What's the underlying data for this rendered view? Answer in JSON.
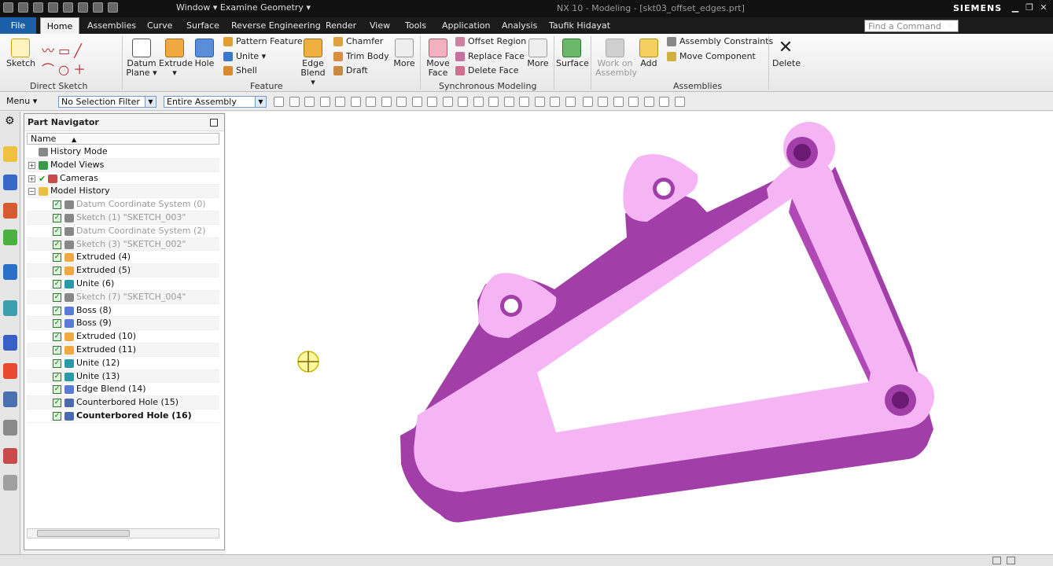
{
  "titlebar": {
    "window_menu": "Window ▾ Examine Geometry ▾",
    "app_title": "NX 10 - Modeling - [skt03_offset_edges.prt]",
    "brand": "SIEMENS"
  },
  "menubar": {
    "tabs": [
      "File",
      "Home",
      "Assemblies",
      "Curve",
      "Surface",
      "Reverse Engineering",
      "Render",
      "View",
      "Tools",
      "Application",
      "Analysis",
      "Taufik Hidayat"
    ],
    "active_tab": "Home",
    "find_placeholder": "Find a Command"
  },
  "ribbon": {
    "direct_sketch": {
      "label": "Direct Sketch",
      "sketch": "Sketch"
    },
    "feature": {
      "label": "Feature",
      "datum_plane": [
        "Datum",
        "Plane ▾"
      ],
      "extrude": [
        "Extrude",
        "▾"
      ],
      "hole": "Hole",
      "pattern_feature": "Pattern Feature",
      "unite": "Unite ▾",
      "shell": "Shell",
      "edge_blend": [
        "Edge",
        "Blend ▾"
      ],
      "chamfer": "Chamfer",
      "trim_body": "Trim Body",
      "draft": "Draft",
      "more": "More"
    },
    "sync": {
      "label": "Synchronous Modeling",
      "move_face": [
        "Move",
        "Face"
      ],
      "offset_region": "Offset Region",
      "replace_face": "Replace Face",
      "delete_face": "Delete Face",
      "more": "More"
    },
    "surface": {
      "label": "Surface"
    },
    "assemblies": {
      "label": "Assemblies",
      "work_on_assembly": [
        "Work on",
        "Assembly"
      ],
      "add": "Add",
      "assembly_constraints": "Assembly Constraints",
      "move_component": "Move Component"
    },
    "delete": "Delete"
  },
  "toolbar2": {
    "menu": "Menu ▾",
    "selection_filter": "No Selection Filter",
    "assembly_scope": "Entire Assembly"
  },
  "navigator": {
    "title": "Part Navigator",
    "column": "Name",
    "items": [
      {
        "label": "History Mode"
      },
      {
        "label": "Model Views"
      },
      {
        "label": "Cameras"
      },
      {
        "label": "Model History"
      },
      {
        "label": "Datum Coordinate System (0)"
      },
      {
        "label": "Sketch (1) \"SKETCH_003\""
      },
      {
        "label": "Datum Coordinate System (2)"
      },
      {
        "label": "Sketch (3) \"SKETCH_002\""
      },
      {
        "label": "Extruded (4)"
      },
      {
        "label": "Extruded (5)"
      },
      {
        "label": "Unite (6)"
      },
      {
        "label": "Sketch (7) \"SKETCH_004\""
      },
      {
        "label": "Boss (8)"
      },
      {
        "label": "Boss (9)"
      },
      {
        "label": "Extruded (10)"
      },
      {
        "label": "Extruded (11)"
      },
      {
        "label": "Unite (12)"
      },
      {
        "label": "Unite (13)"
      },
      {
        "label": "Edge Blend (14)"
      },
      {
        "label": "Counterbored Hole (15)"
      },
      {
        "label": "Counterbored Hole (16)"
      }
    ]
  },
  "model": {
    "face_color": "#f7b6f7",
    "side_color": "#a040a8"
  }
}
